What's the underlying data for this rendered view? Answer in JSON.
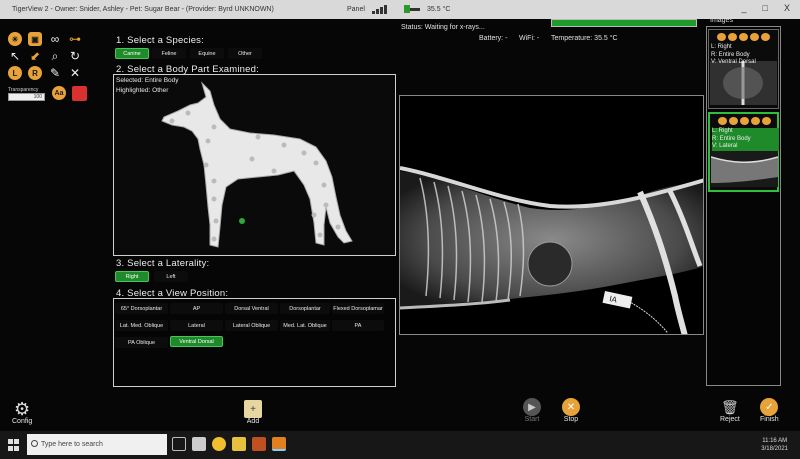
{
  "titlebar": {
    "title": "TigerView 2 - Owner: Snider, Ashley - Pet: Sugar Bear - (Provider: Byrd UNKNOWN)",
    "panel_label": "Panel",
    "temp_small": "35.5 °C",
    "minimize": "_",
    "maximize": "□",
    "close": "X"
  },
  "status": {
    "text": "Status: Waiting for x-rays...",
    "battery": "Battery: -",
    "wifi": "WiFi: -",
    "temperature": "Temperature: 35.5 °C"
  },
  "tools": {
    "transparency_label": "Transparency",
    "transparency_value": "100",
    "aa_label": "Aa",
    "color_swatch": "#d93030"
  },
  "species": {
    "heading": "1. Select a Species:",
    "options": [
      "Canine",
      "Feline",
      "Equine",
      "Other"
    ],
    "selected": "Canine"
  },
  "body_part": {
    "heading": "2. Select a Body Part Examined:",
    "selected_line": "Selected: Entire Body",
    "highlighted_line": "Highlighted: Other"
  },
  "laterality": {
    "heading": "3. Select a Laterality:",
    "options": [
      "Right",
      "Left"
    ],
    "selected": "Right"
  },
  "view_position": {
    "heading": "4. Select a View Position:",
    "options": [
      "65° Dorsoplantar",
      "AP",
      "Dorsal Ventral",
      "Dorsoplantar",
      "Flexed Dorsoplamar",
      "Lat. Med. Oblique",
      "Lateral",
      "Lateral Oblique",
      "Med. Lat. Oblique",
      "PA",
      "PA Oblique",
      "Ventral Dorsal"
    ],
    "selected": "Ventral Dorsal"
  },
  "images": {
    "title": "Images",
    "thumbs": [
      {
        "l": "L: Right",
        "r": "R: Entire Body",
        "v": "V: Ventral Dorsal"
      },
      {
        "l": "L: Right",
        "r": "R: Entire Body",
        "v": "V: Lateral"
      }
    ]
  },
  "actions": {
    "config": "Config",
    "add": "Add",
    "start": "Start",
    "stop": "Stop",
    "reject": "Reject",
    "finish": "Finish"
  },
  "taskbar": {
    "search_placeholder": "Type here to search",
    "time": "11:16 AM",
    "date": "3/18/2021"
  },
  "colors": {
    "accent_orange": "#e8a23a",
    "selected_green": "#1e8a2a",
    "status_green": "#1f9b2b"
  }
}
